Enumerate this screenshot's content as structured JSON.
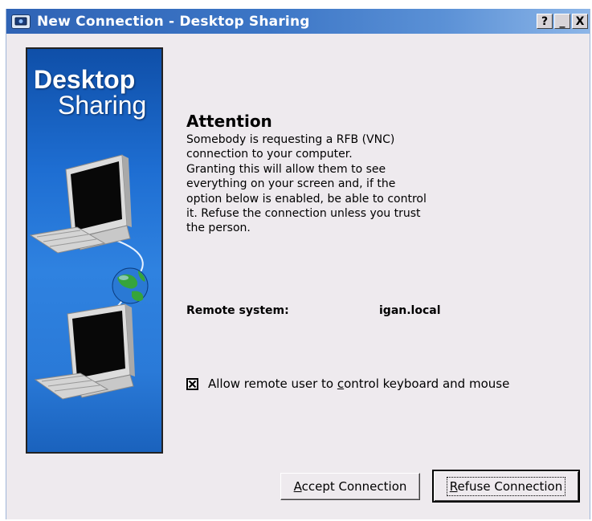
{
  "window": {
    "title": "New Connection - Desktop Sharing",
    "buttons": [
      "?",
      "_",
      "X"
    ]
  },
  "banner": {
    "title_line1": "Desktop",
    "title_line2": "Sharing",
    "icons": [
      "computer-icon",
      "globe-icon",
      "computer-icon"
    ]
  },
  "content": {
    "heading": "Attention",
    "body_lines": [
      "Somebody is requesting a RFB (VNC)",
      "connection to your computer.",
      "Granting this will allow them to see",
      "everything on your screen and, if the",
      "option below is enabled, be able to control",
      "it. Refuse the connection unless you trust",
      "the person."
    ],
    "remote_label": "Remote system:",
    "remote_value": "igan.local"
  },
  "checkbox": {
    "checked": true,
    "label_before": "Allow remote user to ",
    "label_mnemonic": "c",
    "label_after": "ontrol keyboard and mouse"
  },
  "buttons": {
    "accept_mnemonic": "A",
    "accept_rest": "ccept Connection",
    "refuse_mnemonic": "R",
    "refuse_rest": "efuse Connection"
  },
  "colors": {
    "titlebar": "#3c76c6",
    "dialog_bg": "#eeeaee",
    "banner": "#1e6ed2"
  }
}
